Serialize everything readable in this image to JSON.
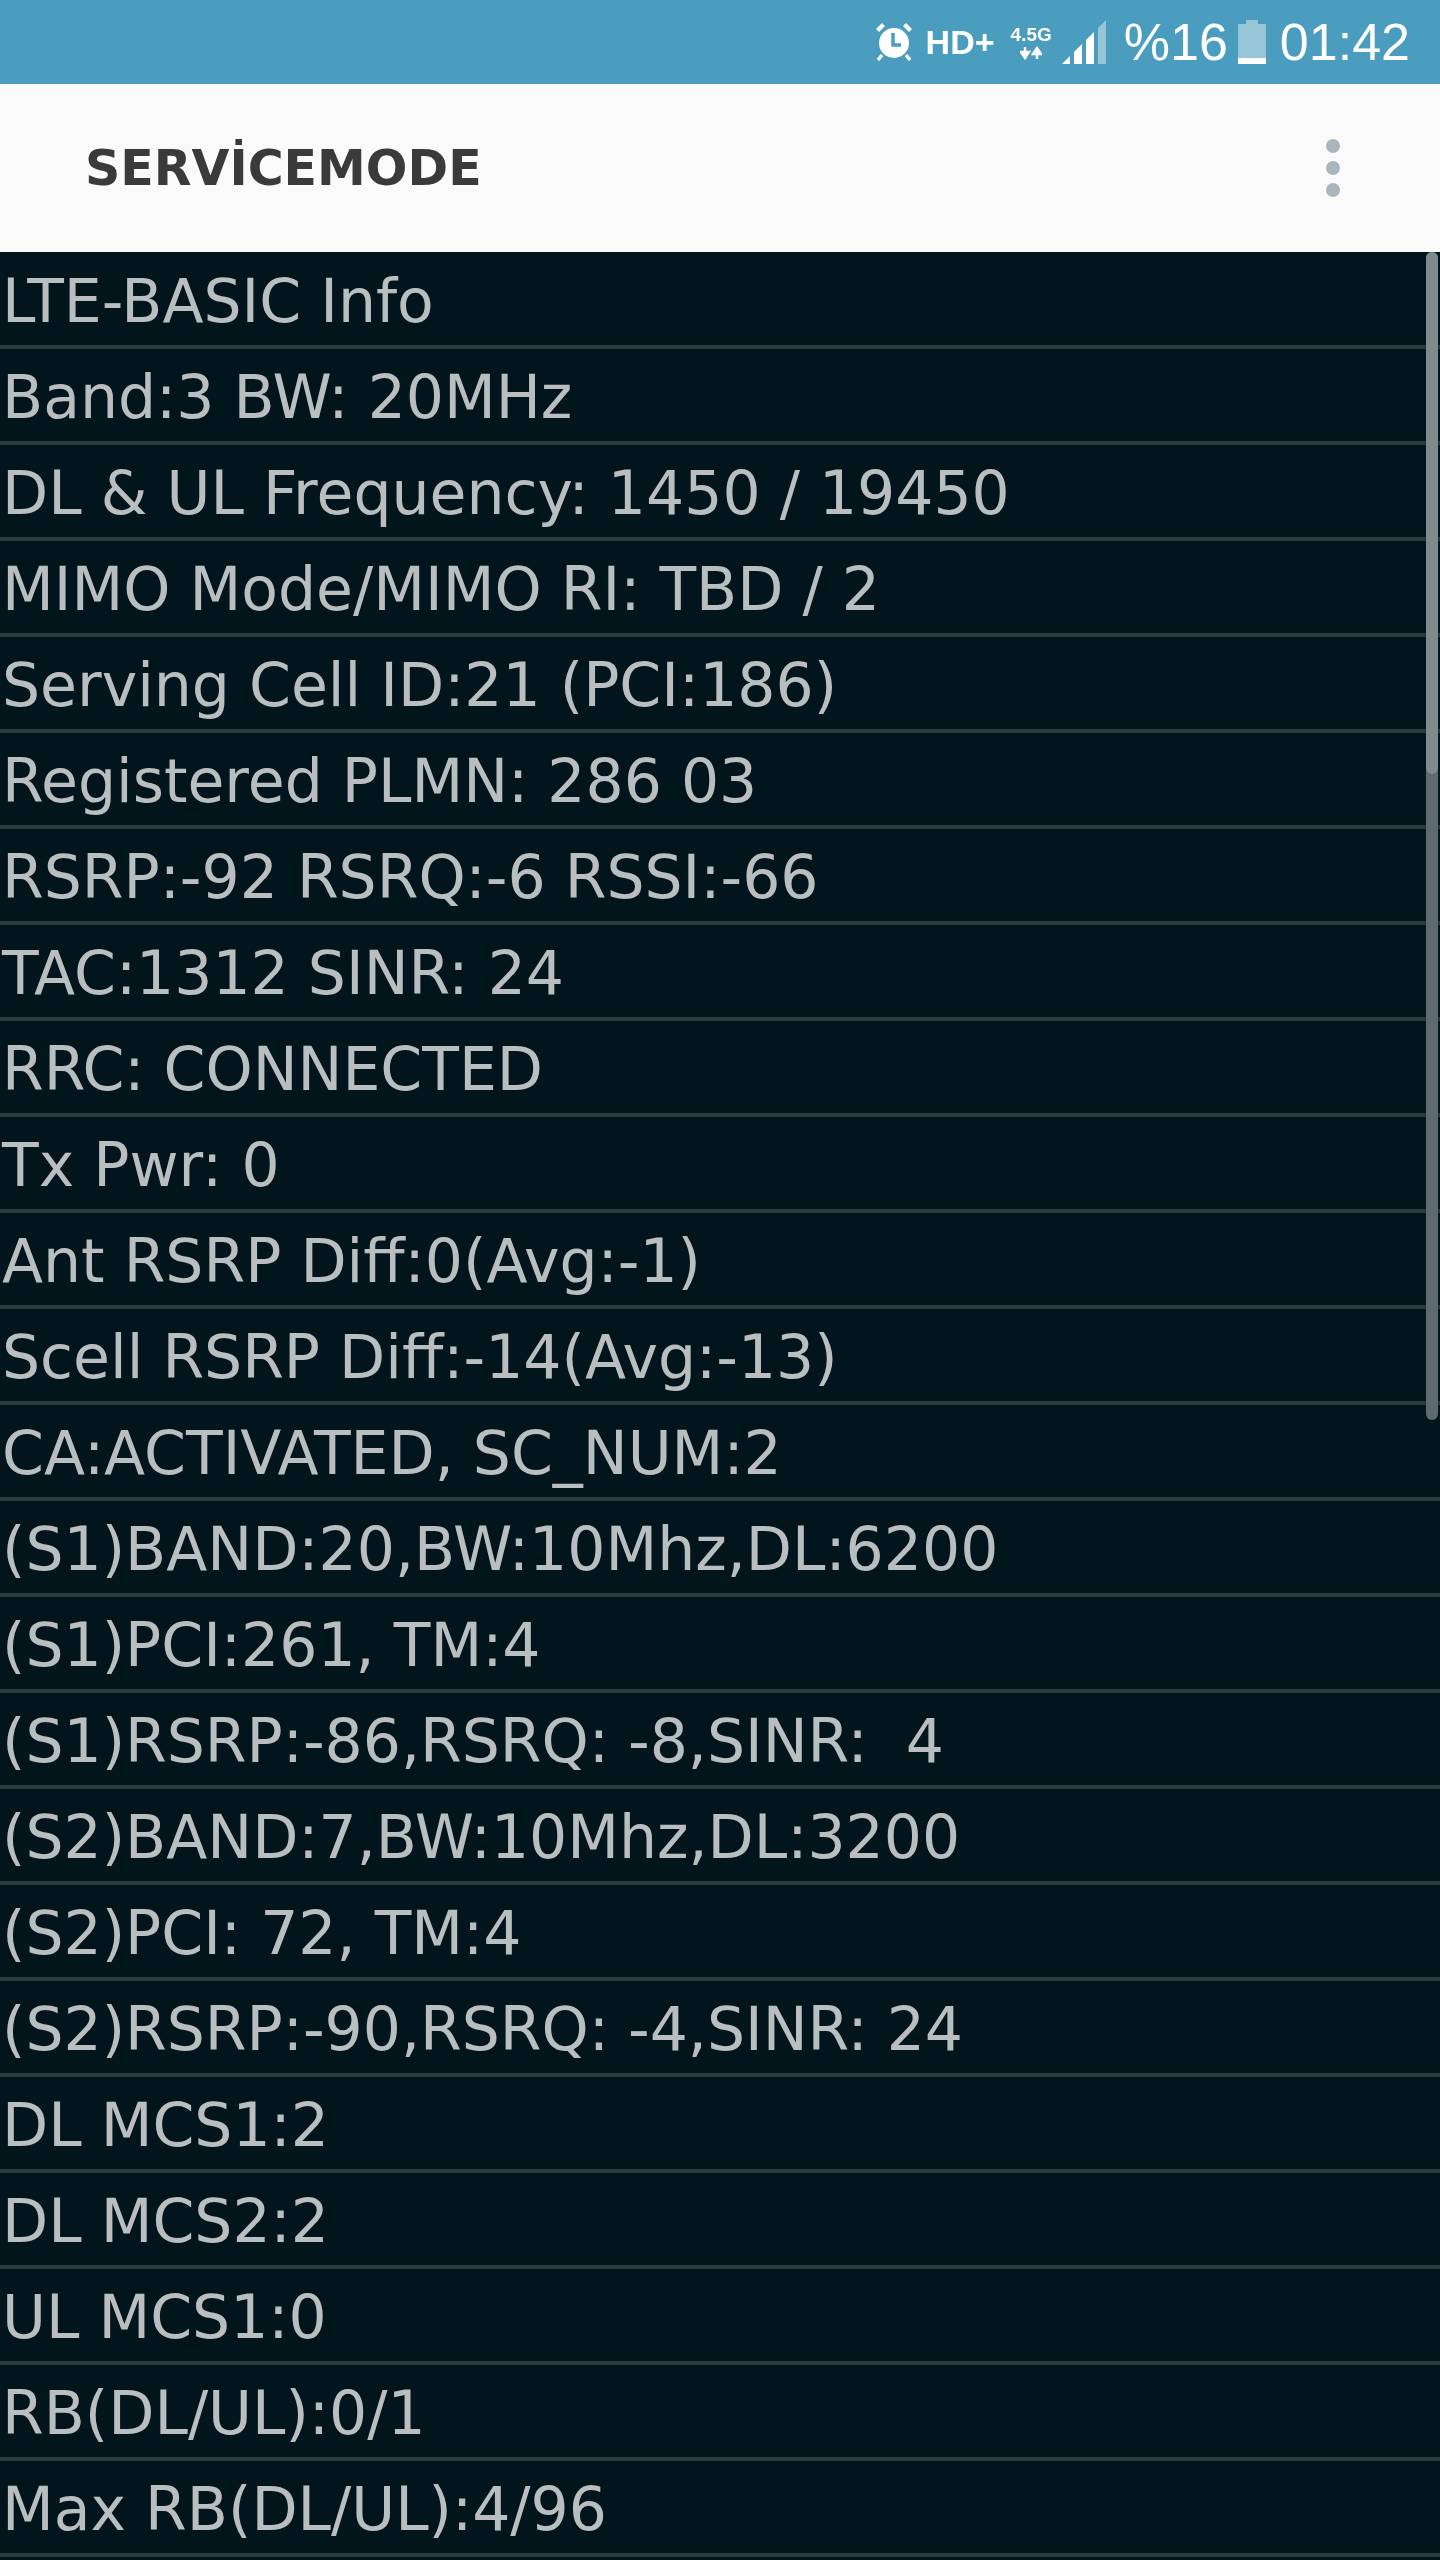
{
  "status_bar": {
    "hd_label": "HD+",
    "network_type": "4.5G",
    "battery_percent": "%16",
    "time": "01:42"
  },
  "app_bar": {
    "title": "SERVİCEMODE"
  },
  "info_lines": [
    "LTE-BASIC Info",
    "Band:3 BW: 20MHz",
    "DL & UL Frequency: 1450 / 19450",
    "MIMO Mode/MIMO RI: TBD / 2",
    "Serving Cell ID:21 (PCI:186)",
    "Registered PLMN: 286 03",
    "RSRP:-92 RSRQ:-6 RSSI:-66",
    "TAC:1312 SINR: 24",
    "RRC: CONNECTED",
    "Tx Pwr: 0",
    "Ant RSRP Diff:0(Avg:-1)",
    "Scell RSRP Diff:-14(Avg:-13)",
    "CA:ACTIVATED, SC_NUM:2",
    "(S1)BAND:20,BW:10Mhz,DL:6200",
    "(S1)PCI:261, TM:4",
    "(S1)RSRP:-86,RSRQ: -8,SINR:  4",
    "(S2)BAND:7,BW:10Mhz,DL:3200",
    "(S2)PCI: 72, TM:4",
    "(S2)RSRP:-90,RSRQ: -4,SINR: 24",
    "DL MCS1:2",
    "DL MCS2:2",
    "UL MCS1:0",
    "RB(DL/UL):0/1",
    "Max RB(DL/UL):4/96"
  ]
}
